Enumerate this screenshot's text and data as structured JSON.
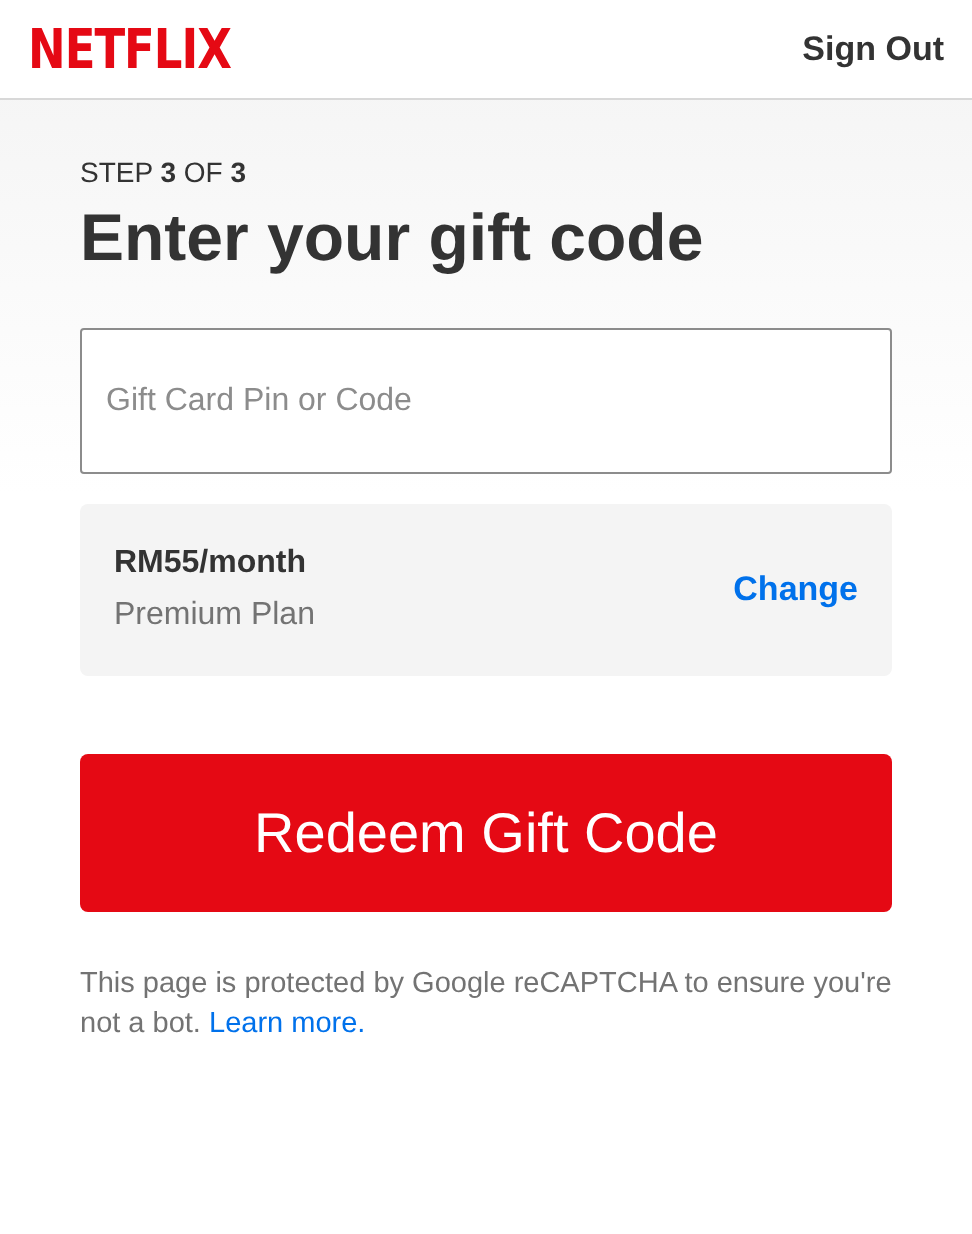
{
  "header": {
    "logo": "NETFLIX",
    "sign_out": "Sign Out"
  },
  "step": "STEP **3** OF **3**",
  "title": "Enter your gift code",
  "code_field": {
    "placeholder": "Gift Card Pin or Code"
  },
  "plan": {
    "price": "RM55/month",
    "name": "Premium Plan",
    "change": "Change"
  },
  "redeem_button": "Redeem Gift Code",
  "notice": {
    "text": "This page is protected by Google reCAPTCHA to ensure you're not a bot.",
    "link": "Learn more."
  }
}
